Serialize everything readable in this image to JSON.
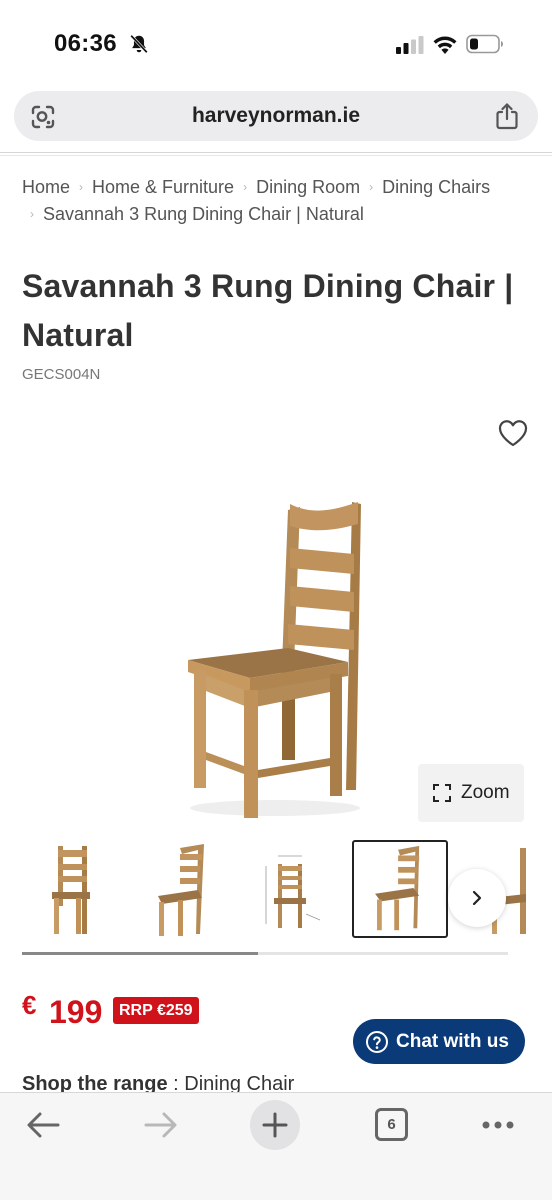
{
  "status_bar": {
    "time": "06:36",
    "icons": [
      "bell-slash-icon",
      "signal-icon",
      "wifi-icon",
      "battery-icon"
    ]
  },
  "url_bar": {
    "url": "harveynorman.ie",
    "icons": [
      "lens-icon",
      "share-icon"
    ]
  },
  "breadcrumb": {
    "items": [
      "Home",
      "Home & Furniture",
      "Dining Room",
      "Dining Chairs",
      "Savannah 3 Rung Dining Chair | Natural"
    ]
  },
  "product": {
    "title": "Savannah 3 Rung Dining Chair | Natural",
    "sku": "GECS004N",
    "zoom_label": "Zoom",
    "thumbnail_count": 5,
    "selected_thumbnail": 4,
    "price_currency": "€",
    "price": "199",
    "rrp": "RRP €259"
  },
  "chat": {
    "label": "Chat with us"
  },
  "range": {
    "label": "Shop the range",
    "separator": " : ",
    "value": "Dining Chair"
  },
  "toolbar": {
    "tab_count": "6",
    "icons": [
      "back-icon",
      "forward-icon",
      "new-tab-icon",
      "tabs-icon",
      "more-icon"
    ]
  },
  "colors": {
    "price_red": "#d0121b",
    "chat_blue": "#0b3a78",
    "wood": "#b48a56"
  }
}
